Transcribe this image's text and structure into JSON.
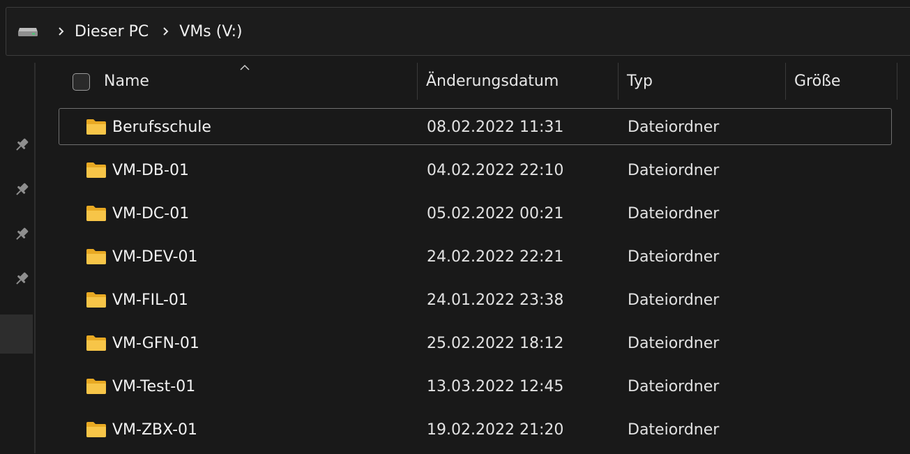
{
  "breadcrumb": {
    "drive_icon": "drive-icon",
    "items": [
      "Dieser PC",
      "VMs (V:)"
    ],
    "separator_icon": "chevron-right-icon"
  },
  "nav_pane": {
    "pins": [
      "pin-icon",
      "pin-icon",
      "pin-icon",
      "pin-icon"
    ]
  },
  "columns": {
    "name": "Name",
    "date": "Änderungsdatum",
    "type": "Typ",
    "size": "Größe",
    "sort_indicator": "sort-ascending-caret"
  },
  "files": [
    {
      "name": "Berufsschule",
      "date": "08.02.2022 11:31",
      "type": "Dateiordner",
      "size": ""
    },
    {
      "name": "VM-DB-01",
      "date": "04.02.2022 22:10",
      "type": "Dateiordner",
      "size": ""
    },
    {
      "name": "VM-DC-01",
      "date": "05.02.2022 00:21",
      "type": "Dateiordner",
      "size": ""
    },
    {
      "name": "VM-DEV-01",
      "date": "24.02.2022 22:21",
      "type": "Dateiordner",
      "size": ""
    },
    {
      "name": "VM-FIL-01",
      "date": "24.01.2022 23:38",
      "type": "Dateiordner",
      "size": ""
    },
    {
      "name": "VM-GFN-01",
      "date": "25.02.2022 18:12",
      "type": "Dateiordner",
      "size": ""
    },
    {
      "name": "VM-Test-01",
      "date": "13.03.2022 12:45",
      "type": "Dateiordner",
      "size": ""
    },
    {
      "name": "VM-ZBX-01",
      "date": "19.02.2022 21:20",
      "type": "Dateiordner",
      "size": ""
    }
  ],
  "colors": {
    "background": "#191919",
    "folder": "#f7c548",
    "text": "#f2f2f2",
    "focus_border": "#707070"
  }
}
